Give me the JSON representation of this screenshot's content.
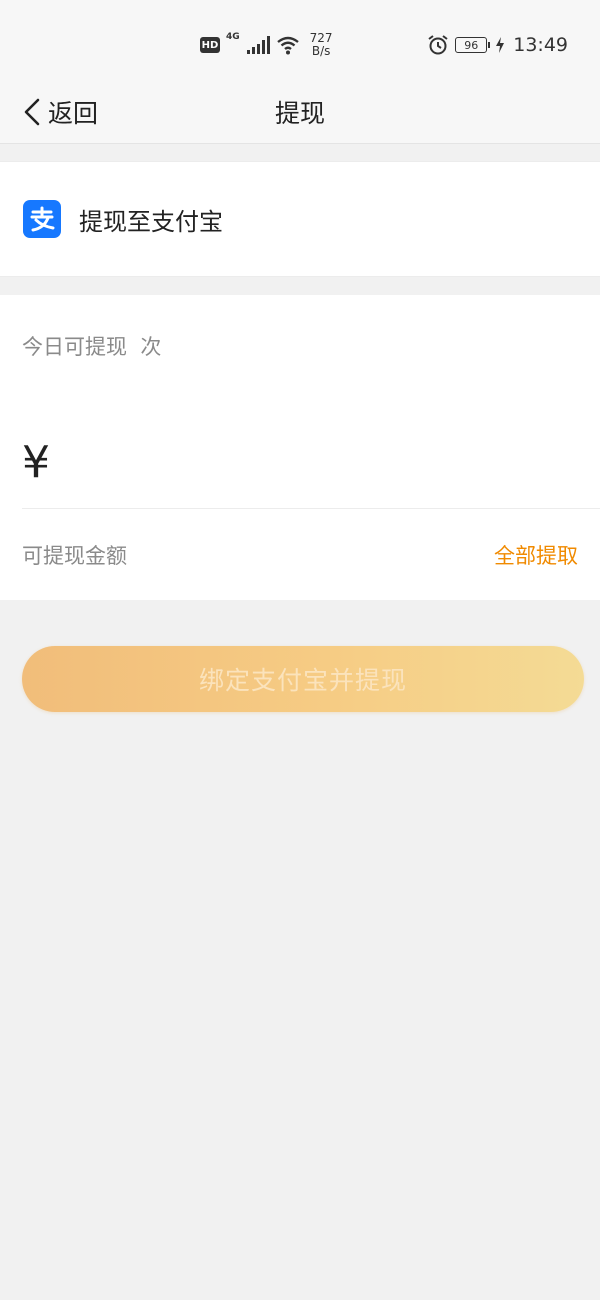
{
  "status_bar": {
    "hd": "HD",
    "network": "4G",
    "speed_value": "727",
    "speed_unit": "B/s",
    "battery": "96",
    "time": "13:49"
  },
  "nav": {
    "back_label": "返回",
    "title": "提现"
  },
  "target": {
    "label": "提现至支付宝",
    "icon": "alipay-icon",
    "icon_color": "#1678ff"
  },
  "withdraw": {
    "today_limit": "今日可提现  次",
    "currency": "¥",
    "amount_value": "",
    "available_label": "可提现金额",
    "withdraw_all_label": "全部提取",
    "accent_color": "#f08a00"
  },
  "submit": {
    "label": "绑定支付宝并提现"
  }
}
